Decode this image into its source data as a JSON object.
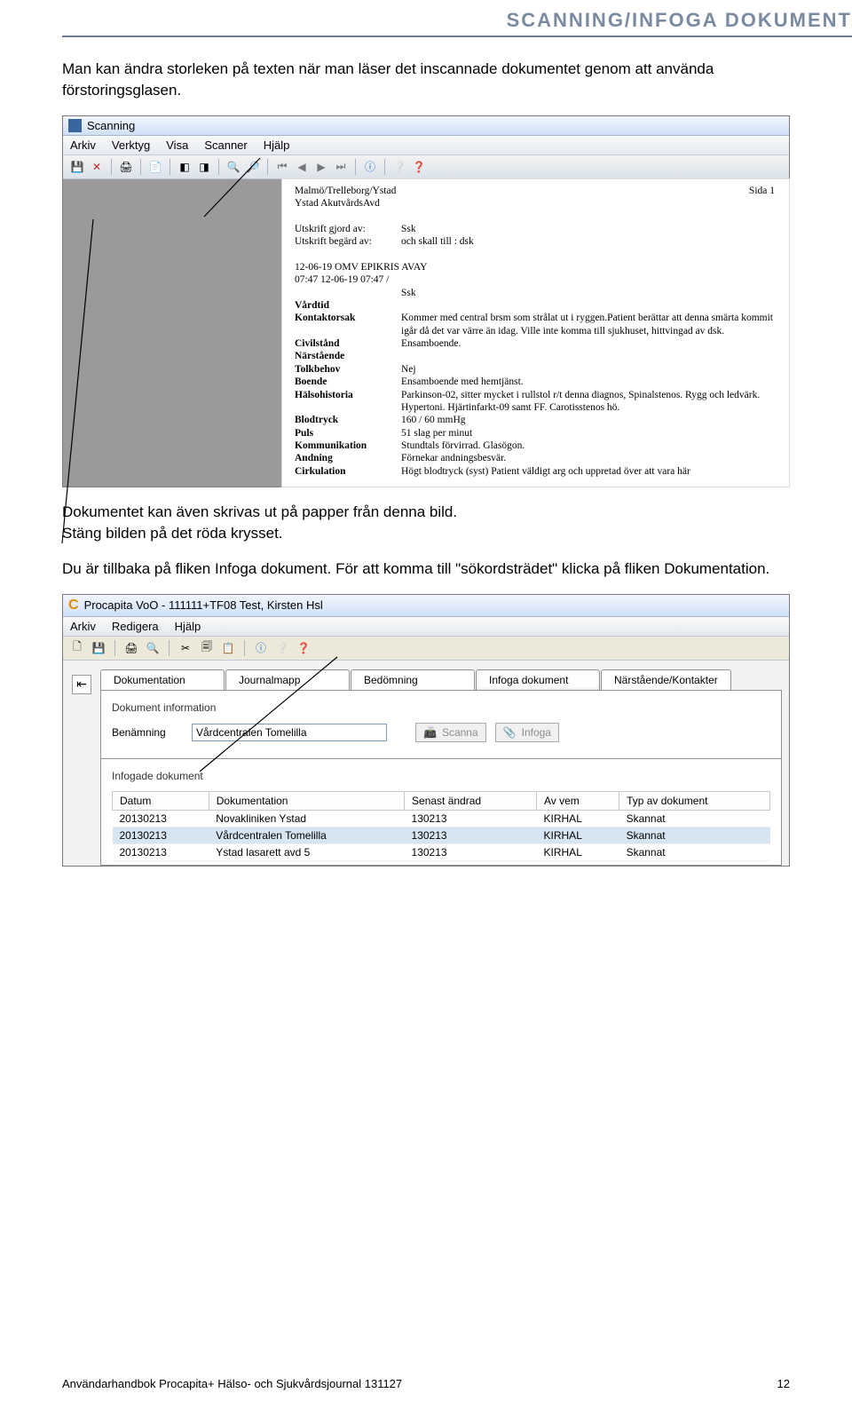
{
  "header": {
    "title": "SCANNING/INFOGA DOKUMENT"
  },
  "para1": "Man kan ändra storleken på texten när man läser det inscannade dokumentet genom att använda förstoringsglasen.",
  "para2": "Dokumentet kan även skrivas ut på papper från denna bild.",
  "para3": "Stäng bilden på det röda krysset.",
  "para4a": "Du är tillbaka på fliken Infoga dokument. För att komma till \"sökordsträdet\" klicka på fliken Dokumentation.",
  "scanwin": {
    "title": "Scanning",
    "menus": [
      "Arkiv",
      "Verktyg",
      "Visa",
      "Scanner",
      "Hjälp"
    ],
    "doc": {
      "orgline1": "Malmö/Trelleborg/Ystad",
      "orgline2": "Ystad AkutvårdsAvd",
      "utskriftGjordLbl": "Utskrift gjord av:",
      "utskriftGjordVal": "Ssk",
      "utskriftBegardLbl": "Utskrift begärd av:",
      "utskriftBegardVal": "och skall till :  dsk",
      "datumline": "12-06-19 OMV EPIKRIS    AVAY",
      "datumline2": "07:47   12-06-19 07:47 /",
      "ssk": "Ssk",
      "rows": [
        {
          "lbl": "Vårdtid",
          "val": ""
        },
        {
          "lbl": "Kontaktorsak",
          "val": "Kommer med central brsm som strålat ut i ryggen.Patient berättar att denna smärta kommit igår då det var värre än idag. Ville inte komma till sjukhuset, hittvingad av dsk."
        },
        {
          "lbl": "Civilstånd",
          "val": "Ensamboende."
        },
        {
          "lbl": "Närstående",
          "val": ""
        },
        {
          "lbl": "Tolkbehov",
          "val": "Nej"
        },
        {
          "lbl": "Boende",
          "val": "Ensamboende med hemtjänst."
        },
        {
          "lbl": "Hälsohistoria",
          "val": "Parkinson-02, sitter mycket i rullstol r/t denna diagnos, Spinalstenos. Rygg och ledvärk. Hypertoni. Hjärtinfarkt-09 samt FF. Carotisstenos hö."
        },
        {
          "lbl": "Blodtryck",
          "val": "160 / 60 mmHg"
        },
        {
          "lbl": "Puls",
          "val": "51  slag per minut"
        },
        {
          "lbl": "Kommunikation",
          "val": "Stundtals förvirrad. Glasögon."
        },
        {
          "lbl": "Andning",
          "val": "Förnekar andningsbesvär."
        },
        {
          "lbl": "Cirkulation",
          "val": "Högt blodtryck (syst) Patient väldigt arg och uppretad över att vara här"
        }
      ],
      "sida": "Sida 1"
    }
  },
  "procwin": {
    "title": "Procapita VoO - 111111+TF08 Test, Kirsten Hsl",
    "menus": [
      "Arkiv",
      "Redigera",
      "Hjälp"
    ],
    "tabs": [
      "Dokumentation",
      "Journalmapp",
      "Bedömning",
      "Infoga dokument",
      "Närstående/Kontakter"
    ],
    "activeTab": 3,
    "groupTitle": "Dokument information",
    "benamningLabel": "Benämning",
    "benamningValue": "Vårdcentralen Tomelilla",
    "btnScanna": "Scanna",
    "btnInfoga": "Infoga",
    "group2Title": "Infogade dokument",
    "tableHeaders": [
      "Datum",
      "Dokumentation",
      "Senast ändrad",
      "Av vem",
      "Typ av dokument"
    ],
    "tableRows": [
      {
        "datum": "20130213",
        "dok": "Novakliniken Ystad",
        "andrad": "130213",
        "av": "KIRHAL",
        "typ": "Skannat"
      },
      {
        "datum": "20130213",
        "dok": "Vårdcentralen Tomelilla",
        "andrad": "130213",
        "av": "KIRHAL",
        "typ": "Skannat",
        "sel": true
      },
      {
        "datum": "20130213",
        "dok": "Ystad lasarett avd 5",
        "andrad": "130213",
        "av": "KIRHAL",
        "typ": "Skannat"
      }
    ]
  },
  "footer": {
    "left": "Användarhandbok Procapita+ Hälso- och Sjukvårdsjournal 131127",
    "right": "12"
  }
}
